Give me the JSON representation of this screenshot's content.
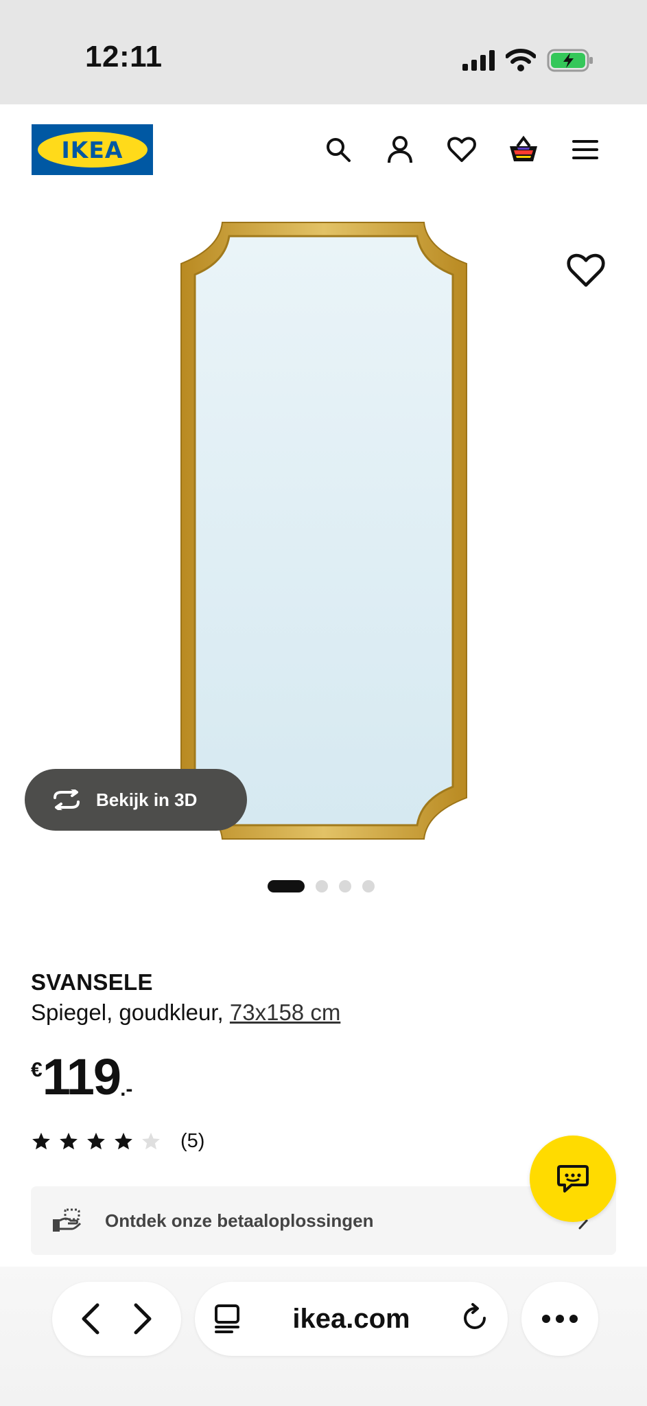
{
  "status_bar": {
    "time": "12:11"
  },
  "header": {
    "logo_text": "IKEA",
    "icons": [
      "search-icon",
      "account-icon",
      "heart-icon",
      "basket-icon",
      "menu-icon"
    ]
  },
  "gallery": {
    "button_3d_label": "Bekijk in 3D",
    "dots_count": 4,
    "active_dot": 1
  },
  "product": {
    "name": "SVANSELE",
    "description": "Spiegel, goudkleur, ",
    "size_link": "73x158 cm",
    "price_currency": "€",
    "price_amount": "119",
    "price_suffix": ".-",
    "rating_value": 4,
    "rating_max": 5,
    "rating_count": "(5)"
  },
  "payment_bar": {
    "label": "Ontdek onze betaaloplossingen"
  },
  "browser": {
    "url": "ikea.com"
  },
  "colors": {
    "ikea_blue": "#0058a3",
    "ikea_yellow": "#ffda1a",
    "chat_yellow": "#ffdb00",
    "frame_gold": "#c9a23c",
    "mirror_glass": "#dfeef4"
  }
}
